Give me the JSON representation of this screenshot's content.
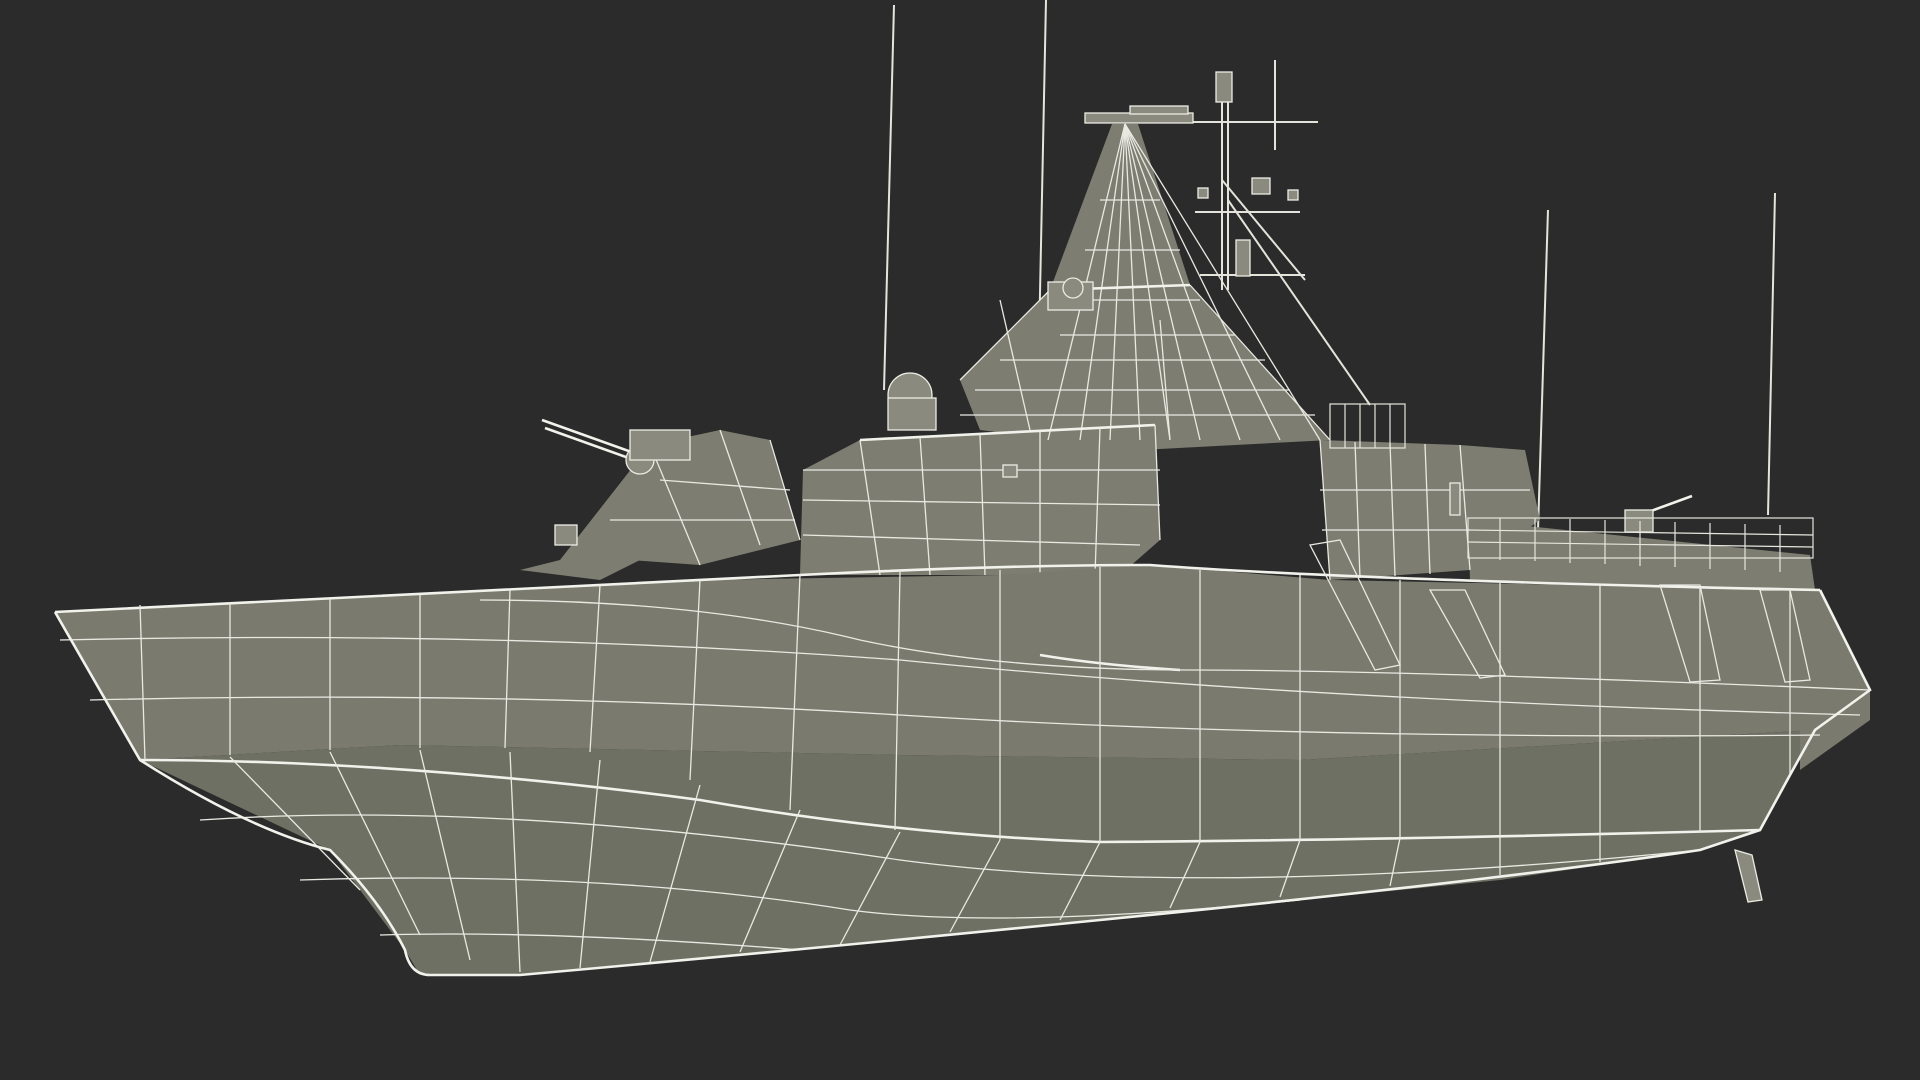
{
  "scene": {
    "background_color": "#2b2b2b",
    "model_fill_color": "#7a7b6e",
    "wire_color": "#e9e9e2"
  }
}
